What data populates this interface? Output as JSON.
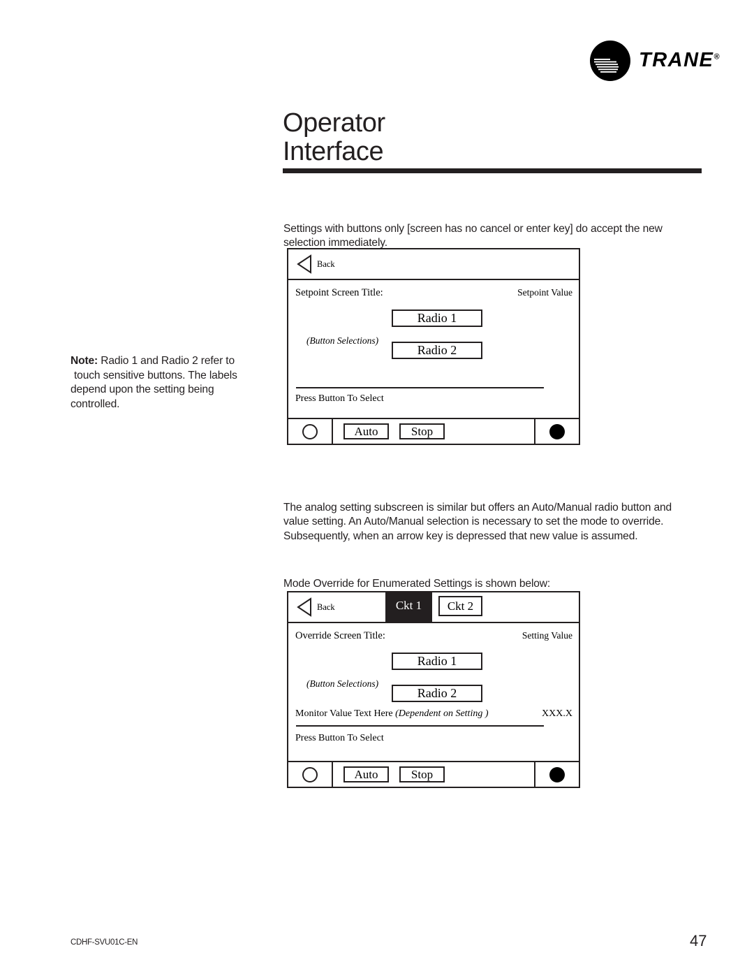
{
  "brand": {
    "name": "TRANE",
    "registered_mark": "®"
  },
  "header": {
    "title_line1": "Operator",
    "title_line2": "Interface"
  },
  "content": {
    "intro_paragraph": "Settings with buttons only [screen has no cancel or enter key] do accept the new selection immediately.",
    "note": {
      "lead": "Note:",
      "line1": " Radio 1 and Radio 2 refer to",
      "line2": "touch sensitive buttons.  The labels",
      "line3": "depend upon the setting being",
      "line4": "controlled."
    },
    "analog_paragraph": "The analog setting subscreen is similar but offers an Auto/Manual radio button and value setting. An Auto/Manual selection is necessary to set the mode to override. Subsequently, when an arrow key is depressed that new value is assumed.",
    "mode_paragraph": "Mode Override for Enumerated Settings is shown below:"
  },
  "setpoint_panel": {
    "back_label": "Back",
    "screen_title": "Setpoint  Screen Title:",
    "value_label": "Setpoint  Value",
    "radio_1": "Radio 1",
    "radio_2": "Radio 2",
    "button_selections_note": "(Button Selections)",
    "press_note": "Press Button To Select",
    "footer": {
      "auto_label": "Auto",
      "stop_label": "Stop"
    }
  },
  "override_panel": {
    "back_label": "Back",
    "tabs": [
      {
        "label": "Ckt 1",
        "selected": true
      },
      {
        "label": "Ckt 2",
        "selected": false
      }
    ],
    "screen_title": "Override Screen Title:",
    "value_label": "Setting   Value",
    "radio_1": "Radio 1",
    "radio_2": "Radio 2",
    "button_selections_note": "(Button Selections)",
    "monitor_text": "Monitor Value Text Here ",
    "monitor_text_dependent": "(Dependent on  Setting  )",
    "monitor_value": "XXX.X",
    "press_note": "Press Button To Select",
    "footer": {
      "auto_label": "Auto",
      "stop_label": "Stop"
    }
  },
  "footer": {
    "doc_code": "CDHF-SVU01C-EN",
    "page_number": "47"
  },
  "colors": {
    "ink": "#231f20",
    "paper": "#ffffff"
  }
}
